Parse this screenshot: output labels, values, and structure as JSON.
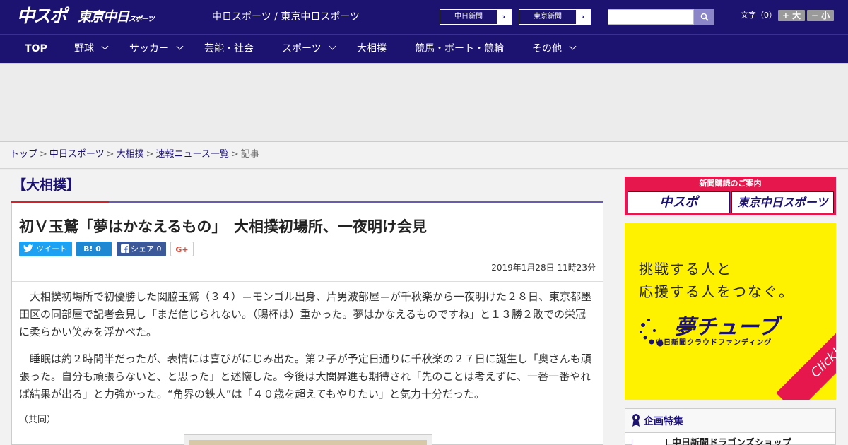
{
  "header": {
    "logo_chunichi": "中スポ",
    "logo_tokyo": "東京中日",
    "logo_tokyo_small": "スポーツ",
    "site_label": "中日スポーツ / 東京中日スポーツ",
    "paper_links": [
      "中日新聞",
      "東京新聞"
    ],
    "font_size_label": "文字（0）",
    "font_larger": "+ 大",
    "font_smaller": "− 小"
  },
  "nav": {
    "items": [
      "TOP",
      "野球",
      "サッカー",
      "芸能・社会",
      "スポーツ",
      "大相撲",
      "競馬・ボート・競輪",
      "その他"
    ]
  },
  "breadcrumb": {
    "items": [
      "トップ",
      "中日スポーツ",
      "大相撲",
      "速報ニュース一覧"
    ],
    "current": "記事",
    "separator": ">"
  },
  "article": {
    "category": "【大相撲】",
    "title": "初Ｖ玉鷲「夢はかなえるもの」　大相撲初場所、一夜明け会見",
    "share": {
      "tweet": "ツイート",
      "hatena": "B! 0",
      "facebook": "シェア 0",
      "gplus": "G+"
    },
    "date": "2019年1月28日 11時23分",
    "paragraphs": [
      "大相撲初場所で初優勝した関脇玉鷲（３４）＝モンゴル出身、片男波部屋＝が千秋楽から一夜明けた２８日、東京都墨田区の同部屋で記者会見し「まだ信じられない。（賜杯は）重かった。夢はかなえるものですね」と１３勝２敗での栄冠に柔らかい笑みを浮かべた。",
      "睡眠は約２時間半だったが、表情には喜びがにじみ出た。第２子が予定日通りに千秋楽の２７日に誕生し「奥さんも頑張った。自分も頑張らないと、と思った」と述懐した。今後は大関昇進も期待され「先のことは考えずに、一番一番やれば結果が出る」と力強かった。“角界の鉄人”は「４０歳を超えてもやりたい」と気力十分だった。"
    ],
    "credit": "（共同）"
  },
  "sidebar": {
    "subscribe_title": "新聞購読のご案内",
    "subscribe_a": "中スポ",
    "subscribe_b": "東京中日スポーツ",
    "banner_line1": "挑戦する人と",
    "banner_line2": "応援する人をつなぐ。",
    "banner_brand": "夢チューブ",
    "banner_sub": "中日新聞クラウドファンディング",
    "banner_click": "Click!",
    "features_title": "企画特集",
    "features_item": "中日新聞ドラゴンズショップ"
  },
  "colors": {
    "brand_navy": "#1c1270",
    "accent_red": "#d6202a",
    "accent_purple": "#6a5ab0",
    "banner_yellow": "#fff200",
    "subscribe_red": "#e5174c"
  }
}
